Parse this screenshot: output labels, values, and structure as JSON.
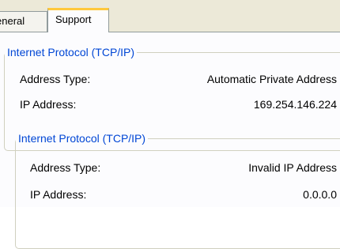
{
  "tabs": [
    {
      "label": "eneral"
    },
    {
      "label": "Support"
    }
  ],
  "groups": [
    {
      "title": "Internet Protocol (TCP/IP)",
      "rows": [
        {
          "label": "Address Type:",
          "value": "Automatic Private Address"
        },
        {
          "label": "IP Address:",
          "value": "169.254.146.224"
        }
      ]
    },
    {
      "title": "Internet Protocol (TCP/IP)",
      "rows": [
        {
          "label": "Address Type:",
          "value": "Invalid IP Address"
        },
        {
          "label": "IP Address:",
          "value": "0.0.0.0"
        }
      ]
    }
  ],
  "colors": {
    "accent": "#0046d5",
    "tab_highlight": "#ffc83c",
    "tabstrip_bg": "#ece9d8",
    "panel_bg": "#fcfcfe"
  }
}
